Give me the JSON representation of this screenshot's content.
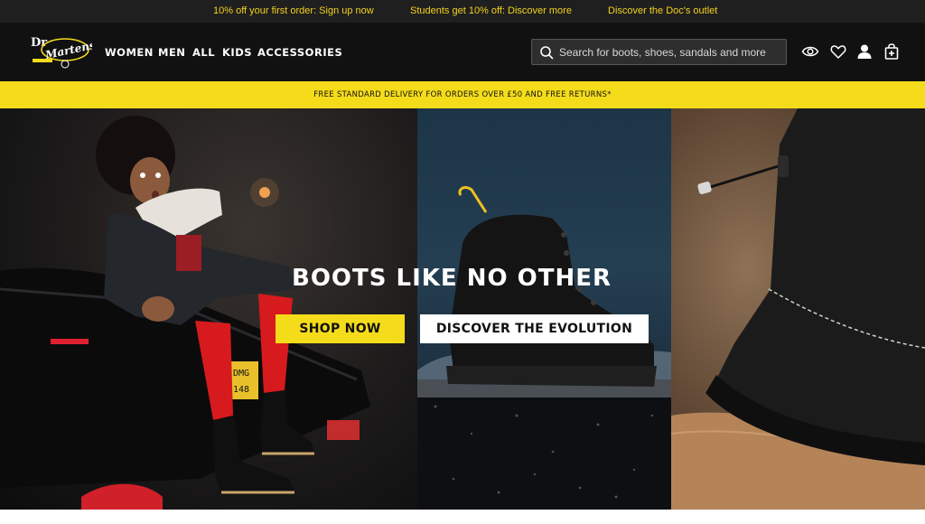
{
  "promo": {
    "first_order": "10% off your first order: Sign up now",
    "students": "Students get 10% off: Discover more",
    "outlet": "Discover the Doc's outlet"
  },
  "header": {
    "logo_text": "Dr. Martens AirWair",
    "nav": [
      "WOMEN",
      "MEN",
      "ALL",
      "KIDS",
      "ACCESSORIES"
    ],
    "search_placeholder": "Search for boots, shoes, sandals and more",
    "icons": [
      "eye-icon",
      "heart-icon",
      "user-icon",
      "bag-icon"
    ]
  },
  "delivery_banner": "FREE STANDARD DELIVERY FOR ORDERS OVER £50 AND FREE RETURNS*",
  "hero": {
    "title": "BOOTS LIKE NO OTHER",
    "shop_now": "SHOP NOW",
    "discover": "DISCOVER THE EVOLUTION"
  },
  "colors": {
    "brand_yellow": "#f5dc1b",
    "header_dark": "#111111",
    "promo_text": "#f3d21d"
  }
}
